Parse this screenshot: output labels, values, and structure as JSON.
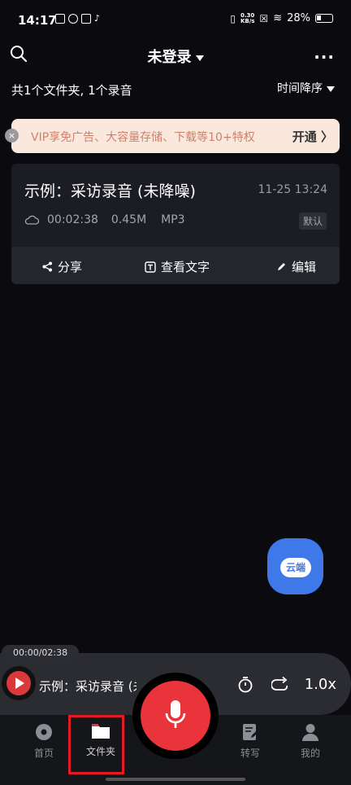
{
  "status": {
    "time": "14:17",
    "speed_top": "0.30",
    "speed_unit": "KB/s",
    "battery": "28%"
  },
  "header": {
    "title": "未登录",
    "more_label": "···"
  },
  "summary": {
    "count_text": "共1个文件夹, 1个录音",
    "sort_label": "时间降序"
  },
  "vip_banner": {
    "close_label": "×",
    "text": "VIP享免广告、大容量存储、下载等10+特权",
    "open_label": "开通 〉"
  },
  "recording": {
    "name": "示例：采访录音 (未降噪)",
    "date": "11-25 13:24",
    "duration": "00:02:38",
    "size": "0.45M",
    "format": "MP3",
    "badge": "默认",
    "actions": {
      "share": "分享",
      "view_text": "查看文字",
      "edit": "编辑"
    }
  },
  "cloud_button": {
    "label": "云端"
  },
  "player": {
    "progress_text": "00:00/02:38",
    "title": "示例：采访录音 (未降",
    "speed": "1.0x"
  },
  "tabs": [
    {
      "label": "首页",
      "icon": "disc-icon"
    },
    {
      "label": "文件夹",
      "icon": "folder-icon"
    },
    {
      "label": "转写",
      "icon": "edit-doc-icon"
    },
    {
      "label": "我的",
      "icon": "person-icon"
    }
  ],
  "colors": {
    "accent_red": "#e8343a",
    "vip_bg": "#fbe8dc",
    "cloud_blue": "#3f78e8"
  }
}
